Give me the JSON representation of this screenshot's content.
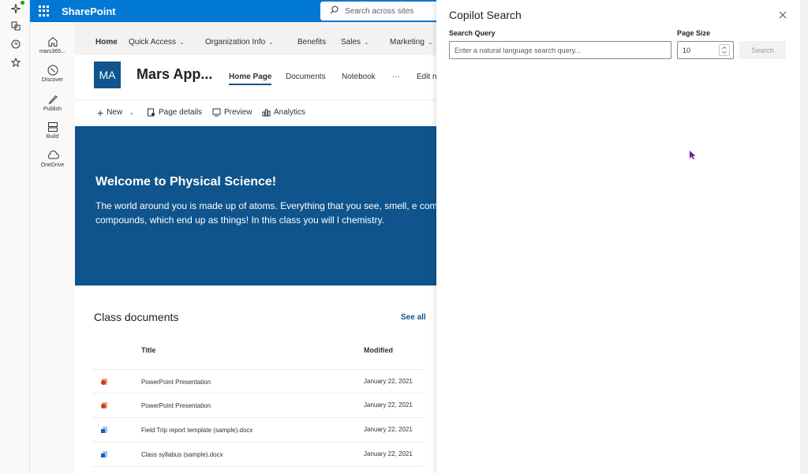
{
  "suite": {
    "brand": "SharePoint",
    "search_placeholder": "Search across sites"
  },
  "appbar": {
    "items": [
      {
        "label": "mars365...",
        "icon": "home-icon"
      },
      {
        "label": "Discover",
        "icon": "compass-icon"
      },
      {
        "label": "Publish",
        "icon": "pen-icon"
      },
      {
        "label": "Build",
        "icon": "build-icon"
      },
      {
        "label": "OneDrive",
        "icon": "cloud-icon"
      }
    ]
  },
  "hubnav": {
    "items": [
      "Home",
      "Quick Access",
      "Organization Info",
      "Benefits",
      "Sales",
      "Marketing"
    ]
  },
  "site": {
    "logo_initials": "MA",
    "title": "Mars App...",
    "nav": [
      "Home Page",
      "Documents",
      "Notebook",
      "···",
      "Edit n"
    ]
  },
  "commands": {
    "new": "New",
    "page_details": "Page details",
    "preview": "Preview",
    "analytics": "Analytics"
  },
  "hero": {
    "title": "Welcome to Physical Science!",
    "text": "The world around you is made up of atoms. Everything that you see, smell, e combine to make compounds, which end up as things! In this class you will l chemistry."
  },
  "documents": {
    "title": "Class documents",
    "see_all": "See all",
    "col_title": "Title",
    "col_modified": "Modified",
    "rows": [
      {
        "name": "PowerPoint Presentation",
        "modified": "January 22, 2021",
        "icon": "powerpoint-icon"
      },
      {
        "name": "PowerPoint Presentation",
        "modified": "January 22, 2021",
        "icon": "powerpoint-icon"
      },
      {
        "name": "Field Trip report template (sample).docx",
        "modified": "January 22, 2021",
        "icon": "word-icon"
      },
      {
        "name": "Class syllabus (sample).docx",
        "modified": "January 22, 2021",
        "icon": "word-icon"
      }
    ]
  },
  "panel": {
    "title": "Copilot Search",
    "query_label": "Search Query",
    "query_placeholder": "Enter a natural language search query...",
    "size_label": "Page Size",
    "size_value": "10",
    "search_button": "Search"
  },
  "colors": {
    "accent": "#0078d4",
    "site_blue": "#0f548c",
    "cursor": "#6b1fa3"
  }
}
